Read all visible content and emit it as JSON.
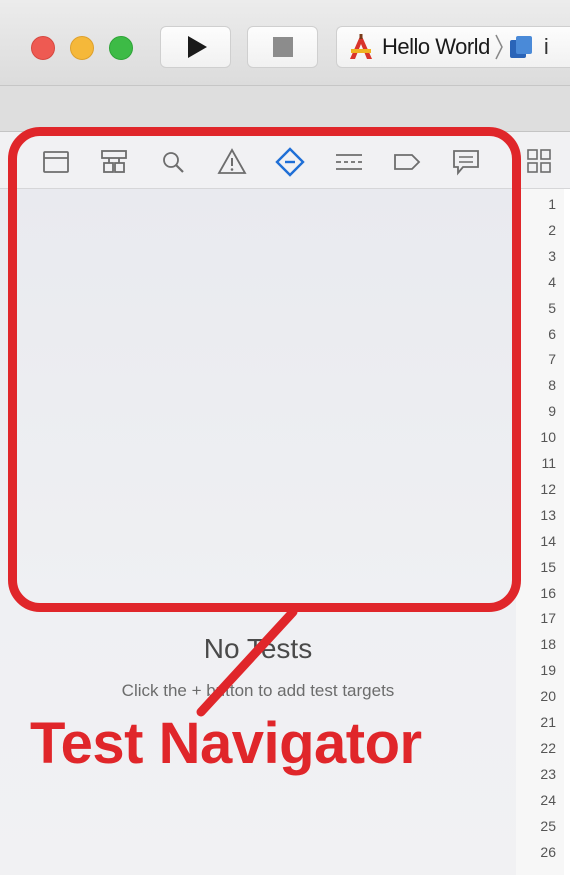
{
  "window": {
    "traffic_lights": [
      {
        "name": "close",
        "color": "#ee5a52"
      },
      {
        "name": "minimize",
        "color": "#f5b83a"
      },
      {
        "name": "zoom",
        "color": "#3dbb46"
      }
    ]
  },
  "toolbar": {
    "run_icon": "play-icon",
    "stop_icon": "stop-icon",
    "scheme_name": "Hello World",
    "scheme_icon": "app-target-icon",
    "device_icon": "ios-device-icon",
    "device_label_partial": "i"
  },
  "navigator": {
    "icons": [
      {
        "name": "project-navigator-icon"
      },
      {
        "name": "symbol-navigator-icon"
      },
      {
        "name": "find-navigator-icon"
      },
      {
        "name": "issue-navigator-icon"
      },
      {
        "name": "test-navigator-icon",
        "selected": true
      },
      {
        "name": "debug-navigator-icon"
      },
      {
        "name": "breakpoint-navigator-icon"
      },
      {
        "name": "report-navigator-icon"
      }
    ],
    "selected_color": "#1f6fd6",
    "empty_title": "No Tests",
    "empty_hint": "Click the + button to add test targets"
  },
  "editor": {
    "related_items_icon": "related-items-icon",
    "line_numbers": [
      "1",
      "2",
      "3",
      "4",
      "5",
      "6",
      "7",
      "8",
      "9",
      "10",
      "11",
      "12",
      "13",
      "14",
      "15",
      "16",
      "17",
      "18",
      "19",
      "20",
      "21",
      "22",
      "23",
      "24",
      "25",
      "26"
    ]
  },
  "annotation": {
    "label": "Test Navigator",
    "color": "#e0262a"
  }
}
